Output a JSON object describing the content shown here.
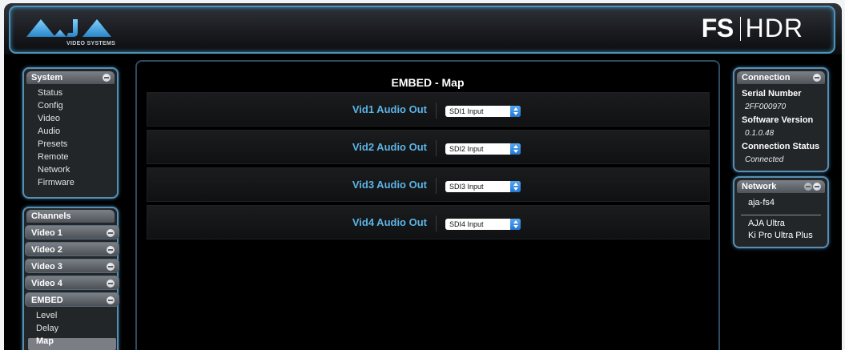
{
  "header": {
    "logo_text": "AJA",
    "logo_sub": "VIDEO SYSTEMS",
    "product_fs": "FS",
    "product_hdr": "HDR"
  },
  "sidebar": {
    "system": {
      "title": "System",
      "items": [
        "Status",
        "Config",
        "Video",
        "Audio",
        "Presets",
        "Remote",
        "Network",
        "Firmware"
      ]
    },
    "channels": {
      "title": "Channels",
      "groups": [
        "Video 1",
        "Video 2",
        "Video 3",
        "Video 4",
        "EMBED"
      ],
      "embed_items": [
        "Level",
        "Delay",
        "Map"
      ],
      "selected": "Map"
    }
  },
  "main": {
    "title": "EMBED - Map",
    "rows": [
      {
        "label": "Vid1 Audio Out",
        "value": "SDI1 Input"
      },
      {
        "label": "Vid2 Audio Out",
        "value": "SDI2 Input"
      },
      {
        "label": "Vid3 Audio Out",
        "value": "SDI3 Input"
      },
      {
        "label": "Vid4 Audio Out",
        "value": "SDI4 Input"
      }
    ]
  },
  "connection": {
    "title": "Connection",
    "serial_label": "Serial Number",
    "serial_value": "2FF000970",
    "software_label": "Software Version",
    "software_value": "0.1.0.48",
    "status_label": "Connection Status",
    "status_value": "Connected"
  },
  "network": {
    "title": "Network",
    "current": "aja-fs4",
    "devices": [
      "AJA Ultra",
      "Ki Pro Ultra Plus"
    ]
  },
  "colors": {
    "accent_blue": "#5cb4e6",
    "panel_border": "#5a8eb0",
    "background": "#000000"
  }
}
